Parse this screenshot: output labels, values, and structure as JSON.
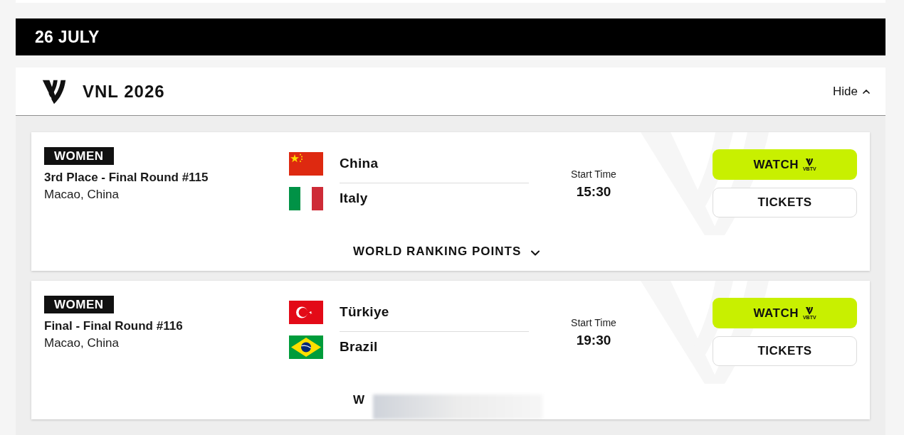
{
  "date_header": {
    "label": "26 JULY"
  },
  "competition": {
    "title": "VNL 2026",
    "toggle": {
      "label": "Hide",
      "expanded": true
    }
  },
  "matches": [
    {
      "category": "WOMEN",
      "title": "3rd Place - Final Round #115",
      "location": "Macao, China",
      "teams": [
        {
          "name": "China",
          "kind": "china"
        },
        {
          "name": "Italy",
          "kind": "italy"
        }
      ],
      "start_time_label": "Start Time",
      "start_time": "15:30",
      "buttons": [
        {
          "kind": "watch",
          "label": "WATCH",
          "logo_text": "VBTV"
        },
        {
          "kind": "tickets",
          "label": "TICKETS"
        }
      ],
      "ranking_toggle": {
        "label": "WORLD RANKING POINTS",
        "expanded": false
      }
    },
    {
      "category": "WOMEN",
      "title": "Final - Final Round #116",
      "location": "Macao, China",
      "teams": [
        {
          "name": "Türkiye",
          "kind": "turkey"
        },
        {
          "name": "Brazil",
          "kind": "brazil"
        }
      ],
      "start_time_label": "Start Time",
      "start_time": "19:30",
      "buttons": [
        {
          "kind": "watch",
          "label": "WATCH",
          "logo_text": "VBTV"
        },
        {
          "kind": "tickets",
          "label": "TICKETS"
        }
      ],
      "ranking_toggle": {
        "label": "W"
      }
    }
  ]
}
